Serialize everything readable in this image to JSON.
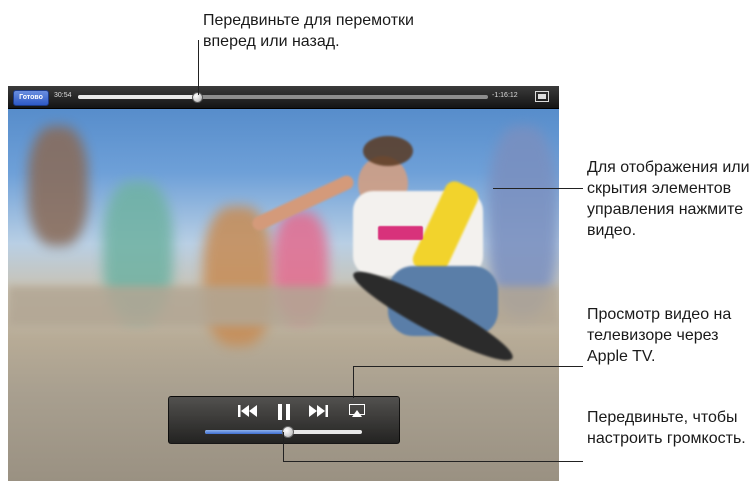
{
  "callouts": {
    "scrub": "Передвиньте для перемотки вперед или назад.",
    "toggle_controls": "Для отображения или скрытия элементов управления нажмите видео.",
    "airplay": "Просмотр видео на телевизоре через Apple TV.",
    "volume": "Передвиньте, чтобы настроить громкость."
  },
  "player": {
    "done_label": "Готово",
    "elapsed": "30:54",
    "remaining": "-1:16:12",
    "scrub_progress": 0.29,
    "volume_level": 0.53
  },
  "icons": {
    "previous": "skip-back-icon",
    "pause": "pause-icon",
    "next": "skip-forward-icon",
    "airplay": "airplay-icon",
    "fill_screen": "fill-screen-icon"
  }
}
